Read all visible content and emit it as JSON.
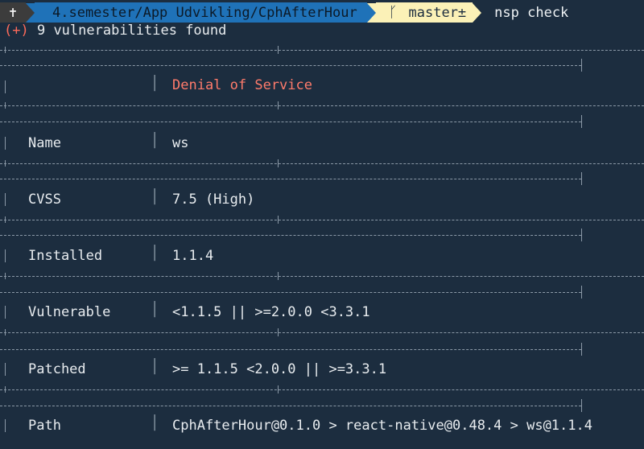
{
  "prompt": {
    "root_symbol": "✝",
    "path": "4.semester/App Udvikling/CphAfterHour",
    "branch_icon": "git-branch-icon",
    "branch": "master±",
    "command": "nsp check"
  },
  "summary": {
    "marker": "(+)",
    "text": "9 vulnerabilities found"
  },
  "vulnerability": {
    "title": "Denial of Service",
    "rows": [
      {
        "key": "Name",
        "value": "ws"
      },
      {
        "key": "CVSS",
        "value": "7.5 (High)"
      },
      {
        "key": "Installed",
        "value": "1.1.4"
      },
      {
        "key": "Vulnerable",
        "value": "<1.1.5 || >=2.0.0 <3.3.1"
      },
      {
        "key": "Patched",
        "value": ">= 1.1.5 <2.0.0 || >=3.3.1"
      },
      {
        "key": "Path",
        "value": "CphAfterHour@0.1.0 > react-native@0.48.4 > ws@1.1.4"
      }
    ]
  },
  "colors": {
    "background": "#1c2d3f",
    "path_segment": "#1f72b8",
    "git_segment": "#fbf1b7",
    "title": "#ff7b6b",
    "marker": "#ff6b5a"
  }
}
